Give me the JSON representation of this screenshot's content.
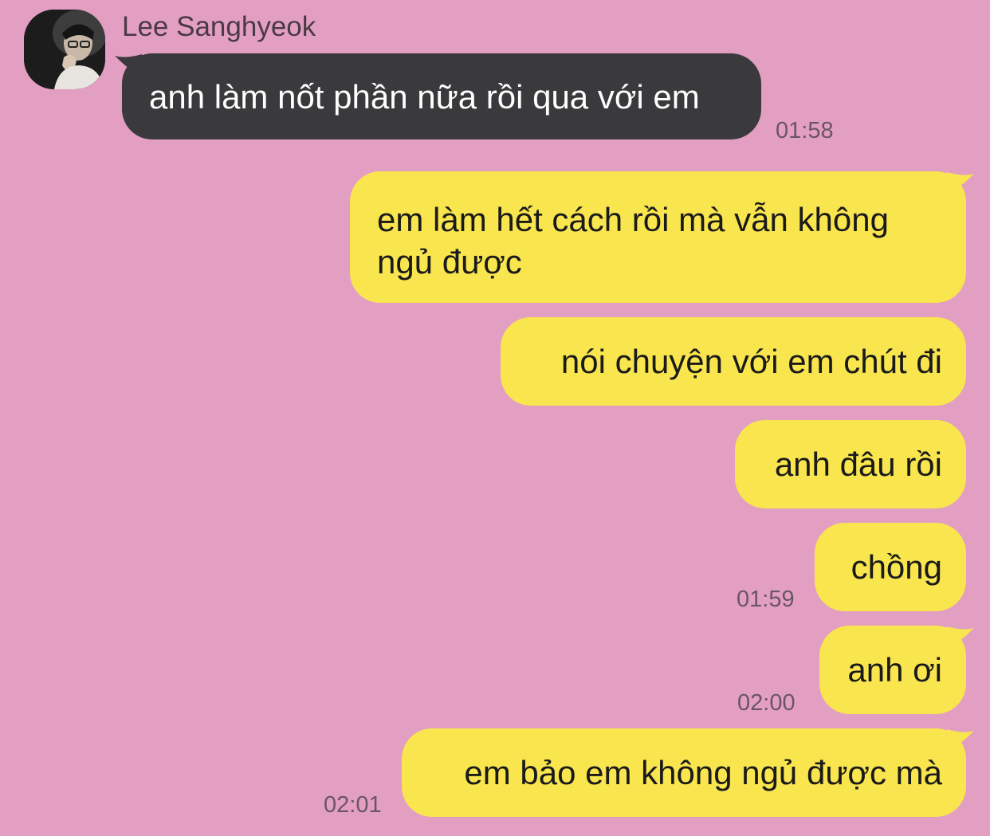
{
  "contact": {
    "name": "Lee Sanghyeok",
    "avatar_icon": "profile-photo"
  },
  "colors": {
    "background": "#e39fc2",
    "incoming_bubble": "#3a3a3c",
    "outgoing_bubble": "#f9e54e"
  },
  "messages": [
    {
      "direction": "incoming",
      "text": "anh làm nốt phần nữa rồi qua với em",
      "time": "01:58"
    },
    {
      "direction": "outgoing",
      "text": "em làm hết cách rồi mà vẫn không ngủ được",
      "time": ""
    },
    {
      "direction": "outgoing",
      "text": "nói chuyện với em chút đi",
      "time": ""
    },
    {
      "direction": "outgoing",
      "text": "anh đâu rồi",
      "time": ""
    },
    {
      "direction": "outgoing",
      "text": "chồng",
      "time": "01:59"
    },
    {
      "direction": "outgoing",
      "text": "anh ơi",
      "time": "02:00"
    },
    {
      "direction": "outgoing",
      "text": "em bảo em không ngủ được mà",
      "time": "02:01"
    }
  ]
}
